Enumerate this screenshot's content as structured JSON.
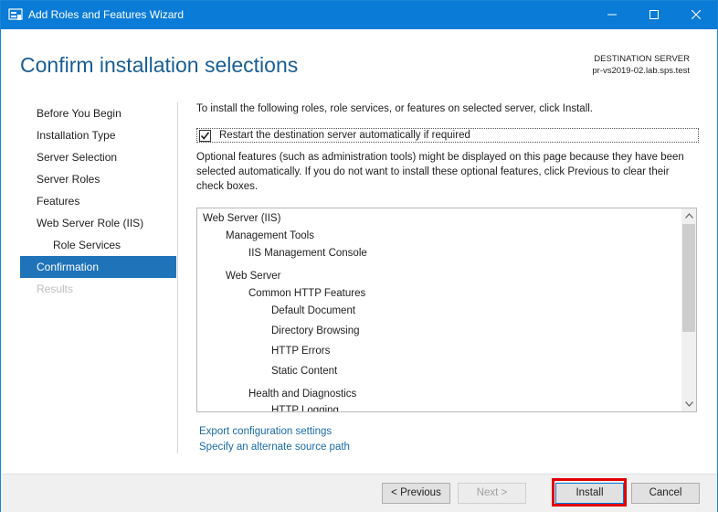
{
  "window": {
    "title": "Add Roles and Features Wizard",
    "accent_color": "#0a7bd7",
    "controls": [
      "minimize-icon",
      "maximize-icon",
      "close-icon"
    ]
  },
  "header": {
    "page_title": "Confirm installation selections",
    "destination_label": "DESTINATION SERVER",
    "destination_server": "pr-vs2019-02.lab.sps.test"
  },
  "nav": {
    "items": [
      {
        "label": "Before You Begin",
        "state": "normal"
      },
      {
        "label": "Installation Type",
        "state": "normal"
      },
      {
        "label": "Server Selection",
        "state": "normal"
      },
      {
        "label": "Server Roles",
        "state": "normal"
      },
      {
        "label": "Features",
        "state": "normal"
      },
      {
        "label": "Web Server Role (IIS)",
        "state": "normal"
      },
      {
        "label": "Role Services",
        "state": "sub"
      },
      {
        "label": "Confirmation",
        "state": "active"
      },
      {
        "label": "Results",
        "state": "disabled"
      }
    ]
  },
  "content": {
    "intro": "To install the following roles, role services, or features on selected server, click Install.",
    "restart_label": "Restart the destination server automatically if required",
    "restart_checked": true,
    "optional_text": "Optional features (such as administration tools) might be displayed on this page because they have been selected automatically. If you do not want to install these optional features, click Previous to clear their check boxes."
  },
  "selections": [
    {
      "label": "Web Server (IIS)",
      "level": 0
    },
    {
      "label": "Management Tools",
      "level": 1
    },
    {
      "label": "IIS Management Console",
      "level": 2
    },
    {
      "label": "Web Server",
      "level": 1
    },
    {
      "label": "Common HTTP Features",
      "level": 2
    },
    {
      "label": "Default Document",
      "level": 3
    },
    {
      "label": "Directory Browsing",
      "level": 3
    },
    {
      "label": "HTTP Errors",
      "level": 3
    },
    {
      "label": "Static Content",
      "level": 3
    },
    {
      "label": "Health and Diagnostics",
      "level": 2
    },
    {
      "label": "HTTP Logging",
      "level": 3
    }
  ],
  "links": {
    "export": "Export configuration settings",
    "alternate_source": "Specify an alternate source path"
  },
  "buttons": {
    "previous": "< Previous",
    "next": "Next >",
    "install": "Install",
    "cancel": "Cancel"
  },
  "highlight_color": "#e00000"
}
